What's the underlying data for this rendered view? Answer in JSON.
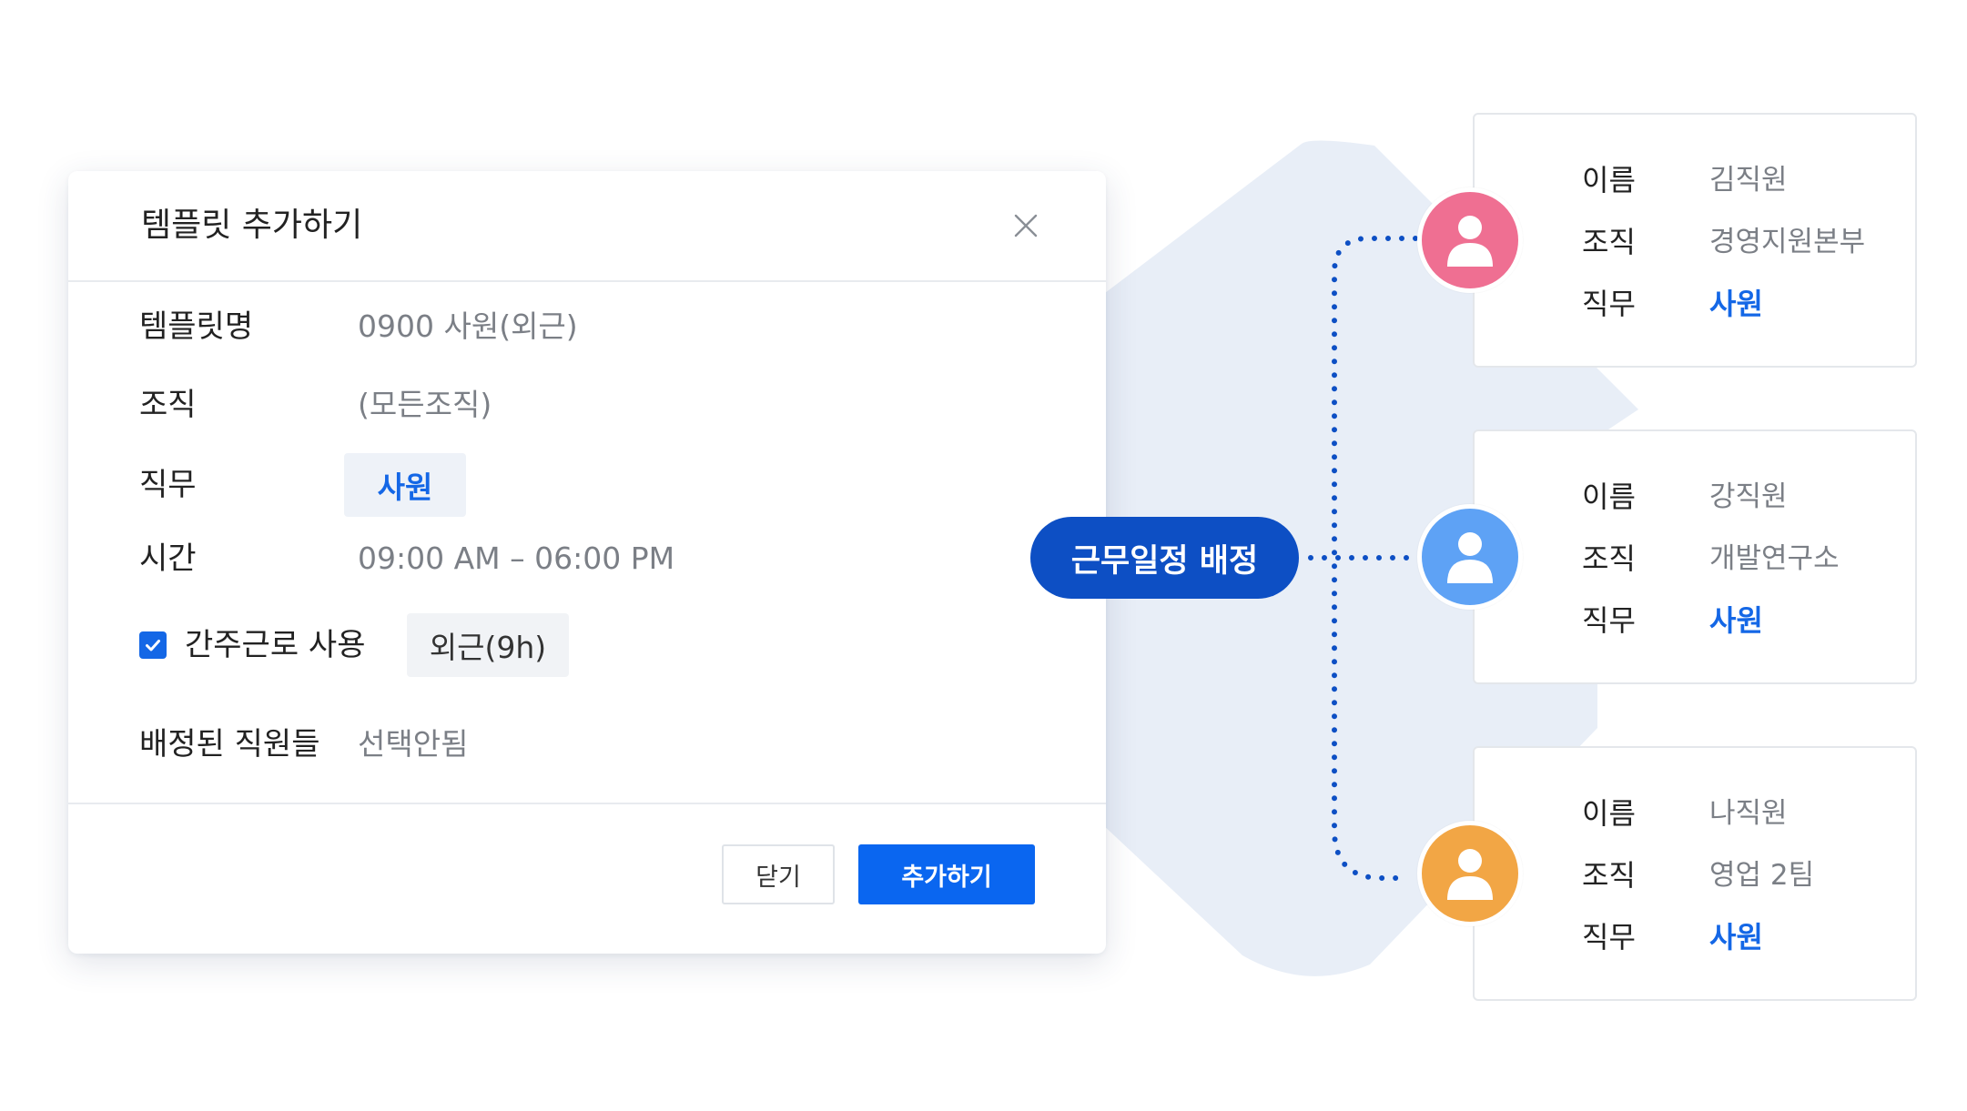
{
  "modal": {
    "title": "템플릿 추가하기",
    "fields": {
      "template_name": {
        "label": "템플릿명",
        "value": "0900 사원(외근)"
      },
      "organization": {
        "label": "조직",
        "value": "(모든조직)"
      },
      "role": {
        "label": "직무",
        "value": "사원"
      },
      "time": {
        "label": "시간",
        "value": "09:00 AM – 06:00 PM"
      },
      "deemed_work": {
        "label": "간주근로 사용",
        "checked": true,
        "value": "외근(9h)"
      },
      "assigned": {
        "label": "배정된 직원들",
        "value": "선택안됨"
      }
    },
    "buttons": {
      "close": "닫기",
      "add": "추가하기"
    }
  },
  "assign_label": "근무일정 배정",
  "employees": [
    {
      "name_label": "이름",
      "name": "김직원",
      "org_label": "조직",
      "org": "경영지원본부",
      "role_label": "직무",
      "role": "사원",
      "avatar_color": "#ef6f92"
    },
    {
      "name_label": "이름",
      "name": "강직원",
      "org_label": "조직",
      "org": "개발연구소",
      "role_label": "직무",
      "role": "사원",
      "avatar_color": "#5ea2f5"
    },
    {
      "name_label": "이름",
      "name": "나직원",
      "org_label": "조직",
      "org": "영업 2팀",
      "role_label": "직무",
      "role": "사원",
      "avatar_color": "#f2a645"
    }
  ],
  "colors": {
    "accent": "#1467e6",
    "primary_button": "#0a66f0",
    "assign_pill": "#0d4fc4",
    "background_shape": "#e8eef7"
  }
}
